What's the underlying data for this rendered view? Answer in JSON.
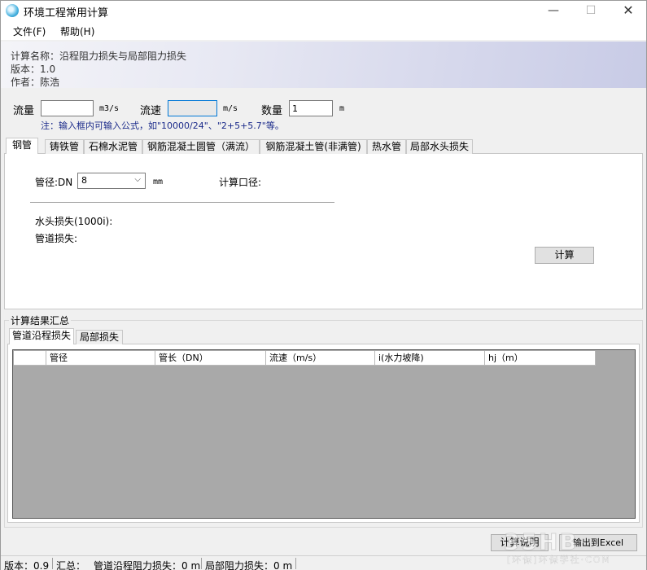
{
  "window": {
    "title": "环境工程常用计算",
    "min": "—",
    "max": "☐",
    "close": "✕"
  },
  "menu": {
    "file": "文件(F)",
    "help": "帮助(H)"
  },
  "banner": {
    "name": "计算名称：沿程阻力损失与局部阻力损失",
    "version": "版本：1.0",
    "author": "作者：陈浩"
  },
  "inputs": {
    "flow_label": "流量",
    "flow_value": "",
    "flow_unit": "m3/s",
    "velocity_label": "流速",
    "velocity_value": "",
    "velocity_unit": "m/s",
    "count_label": "数量",
    "count_value": "1",
    "count_unit": "m",
    "note": "注：输入框内可输入公式，如\"10000/24\"、\"2+5+5.7\"等。"
  },
  "tabs": [
    "钢管",
    "铸铁管",
    "石棉水泥管",
    "钢筋混凝土圆管（满流）",
    "钢筋混凝土管(非满管)",
    "热水管",
    "局部水头损失"
  ],
  "panel": {
    "diameter_label": "管径:DN",
    "diameter_value": "8",
    "diameter_unit": "mm",
    "calc_diameter_label": "计算口径:",
    "head_loss_label": "水头损失(1000i):",
    "pipe_loss_label": "管道损失:",
    "calc_button": "计算"
  },
  "results": {
    "group_title": "计算结果汇总",
    "tabs": [
      "管道沿程损失",
      "局部损失"
    ],
    "columns": [
      "",
      "管径",
      "管长（DN）",
      "流速（m/s）",
      "i(水力坡降)",
      "hj（m）"
    ]
  },
  "footer_buttons": {
    "explain": "计算说明",
    "export": "输出到Excel"
  },
  "status": {
    "version": "版本：0.9",
    "summary": "汇总：",
    "pipe_loss": "管道沿程阻力损失：0 m",
    "local_loss": "局部阻力损失：0 m"
  },
  "watermark": {
    "big": "35HB",
    "small": "[环保]环保学社·COM"
  }
}
